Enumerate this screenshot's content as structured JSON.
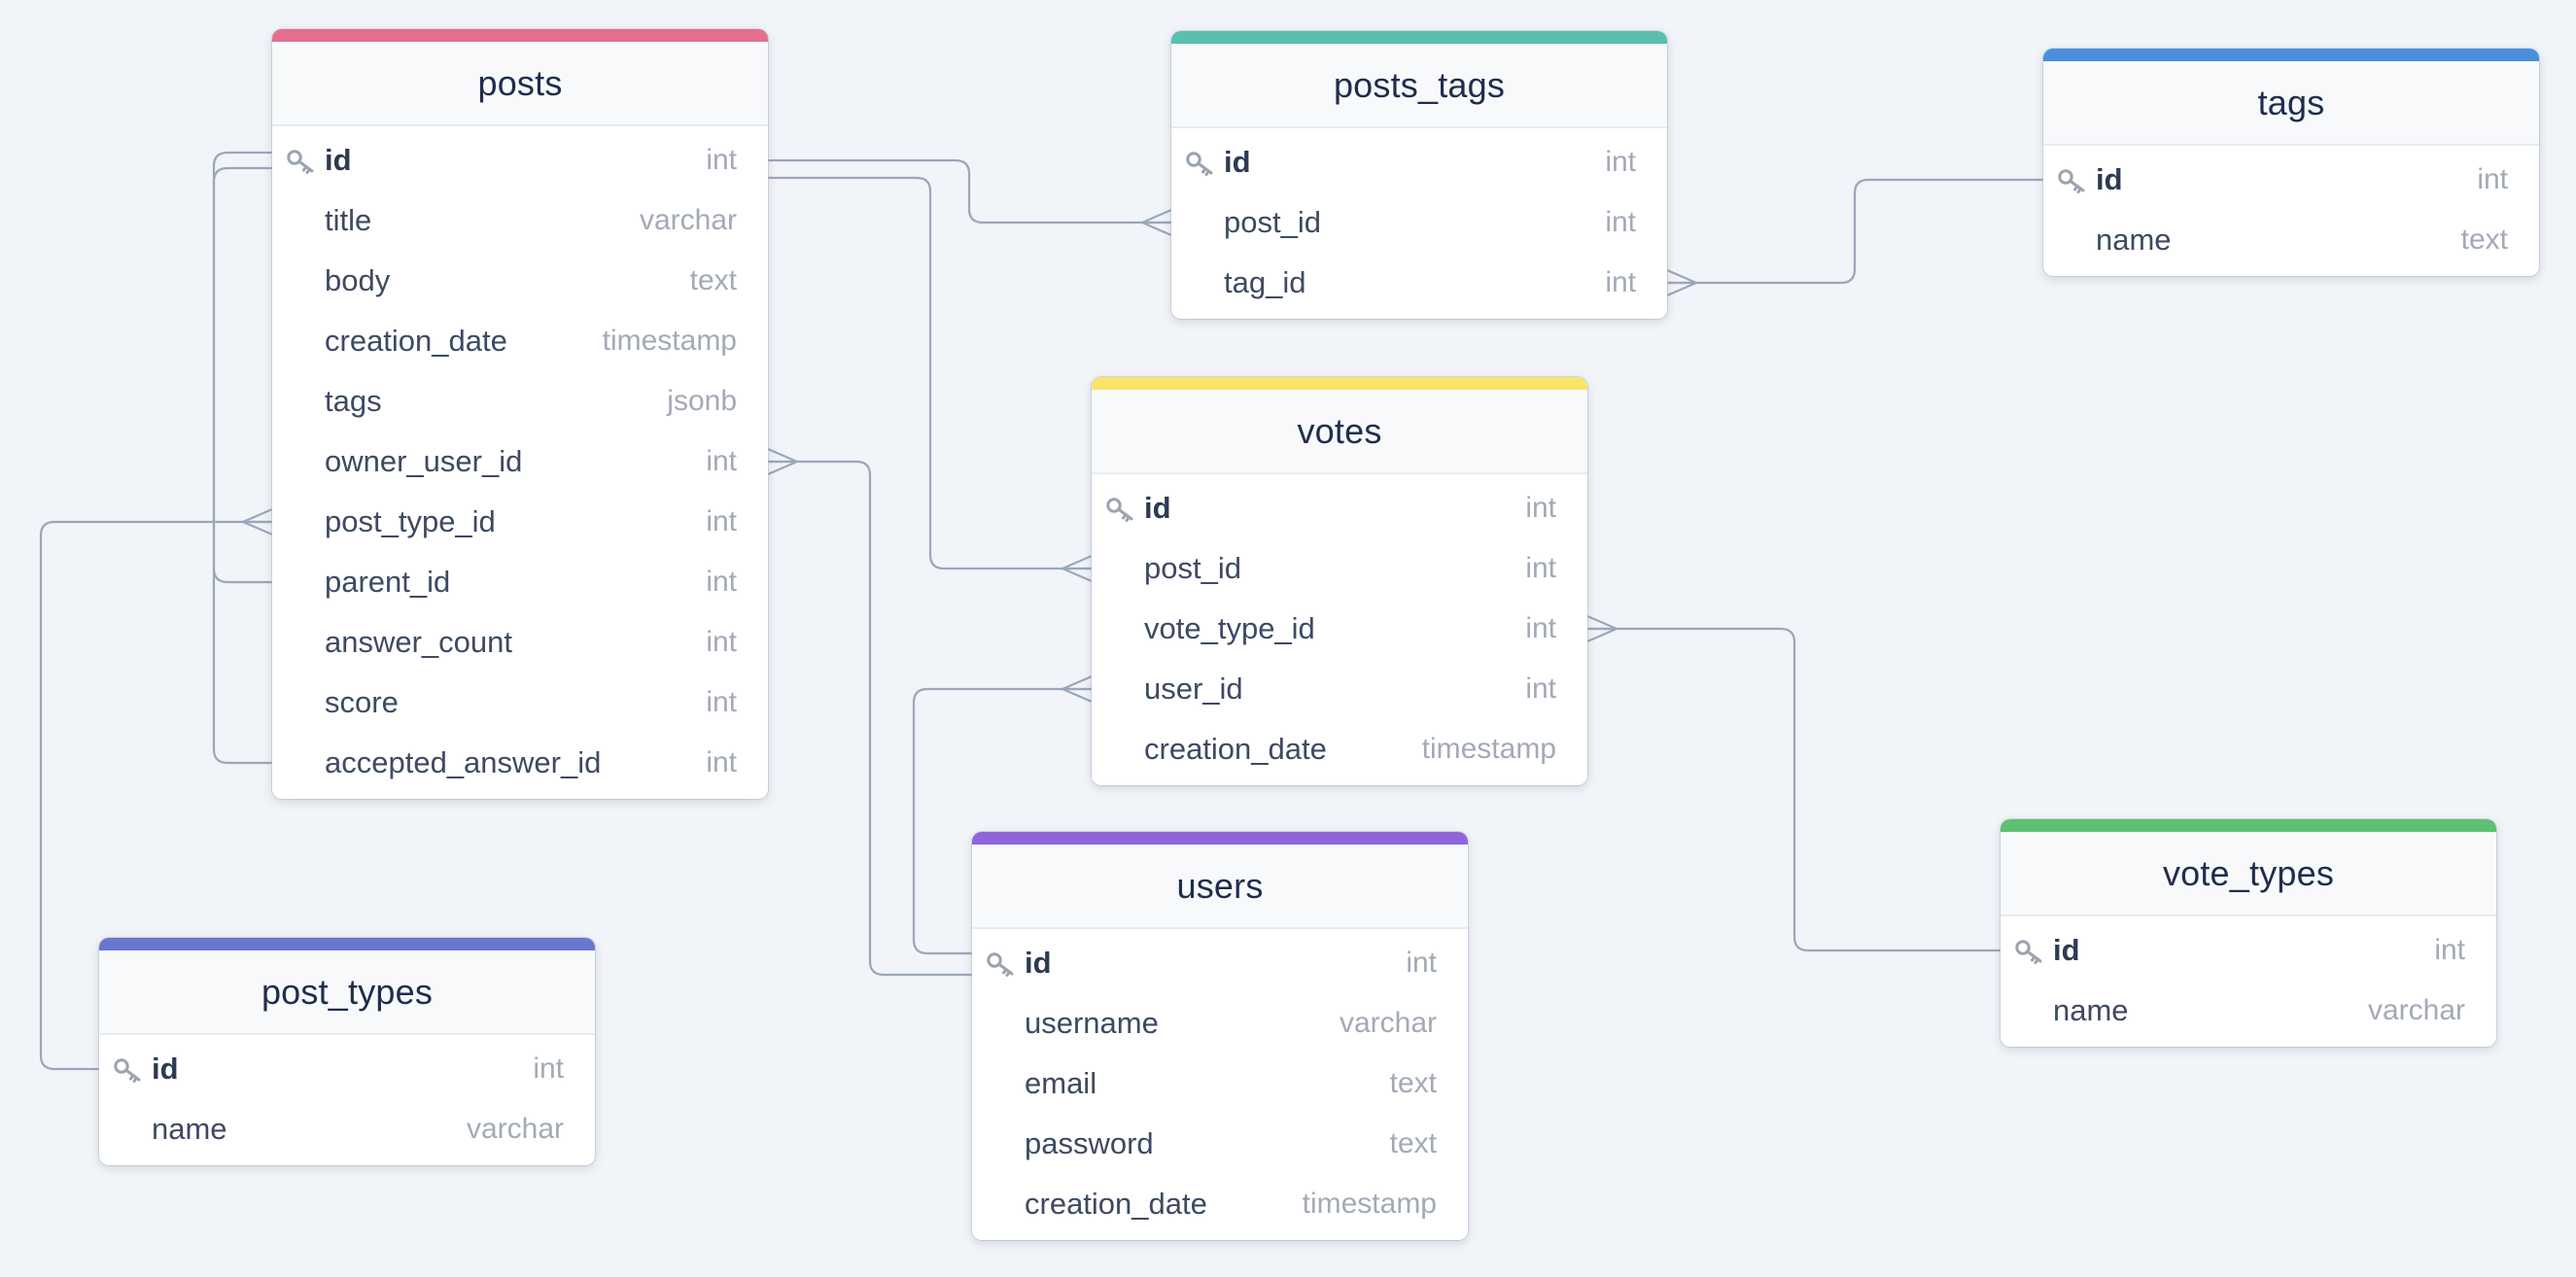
{
  "tables": [
    {
      "key": "posts",
      "name": "posts",
      "color": "#e2708e",
      "columns": [
        {
          "name": "id",
          "type": "int",
          "pk": true
        },
        {
          "name": "title",
          "type": "varchar"
        },
        {
          "name": "body",
          "type": "text"
        },
        {
          "name": "creation_date",
          "type": "timestamp"
        },
        {
          "name": "tags",
          "type": "jsonb"
        },
        {
          "name": "owner_user_id",
          "type": "int"
        },
        {
          "name": "post_type_id",
          "type": "int"
        },
        {
          "name": "parent_id",
          "type": "int"
        },
        {
          "name": "answer_count",
          "type": "int"
        },
        {
          "name": "score",
          "type": "int"
        },
        {
          "name": "accepted_answer_id",
          "type": "int"
        }
      ]
    },
    {
      "key": "posts_tags",
      "name": "posts_tags",
      "color": "#5bbfb0",
      "columns": [
        {
          "name": "id",
          "type": "int",
          "pk": true
        },
        {
          "name": "post_id",
          "type": "int"
        },
        {
          "name": "tag_id",
          "type": "int"
        }
      ]
    },
    {
      "key": "tags",
      "name": "tags",
      "color": "#4a8fdc",
      "columns": [
        {
          "name": "id",
          "type": "int",
          "pk": true
        },
        {
          "name": "name",
          "type": "text"
        }
      ]
    },
    {
      "key": "votes",
      "name": "votes",
      "color": "#f9e46a",
      "columns": [
        {
          "name": "id",
          "type": "int",
          "pk": true
        },
        {
          "name": "post_id",
          "type": "int"
        },
        {
          "name": "vote_type_id",
          "type": "int"
        },
        {
          "name": "user_id",
          "type": "int"
        },
        {
          "name": "creation_date",
          "type": "timestamp"
        }
      ]
    },
    {
      "key": "users",
      "name": "users",
      "color": "#8f66d9",
      "columns": [
        {
          "name": "id",
          "type": "int",
          "pk": true
        },
        {
          "name": "username",
          "type": "varchar"
        },
        {
          "name": "email",
          "type": "text"
        },
        {
          "name": "password",
          "type": "text"
        },
        {
          "name": "creation_date",
          "type": "timestamp"
        }
      ]
    },
    {
      "key": "post_types",
      "name": "post_types",
      "color": "#6a77cf",
      "columns": [
        {
          "name": "id",
          "type": "int",
          "pk": true
        },
        {
          "name": "name",
          "type": "varchar"
        }
      ]
    },
    {
      "key": "vote_types",
      "name": "vote_types",
      "color": "#5fbf72",
      "columns": [
        {
          "name": "id",
          "type": "int",
          "pk": true
        },
        {
          "name": "name",
          "type": "varchar"
        }
      ]
    }
  ],
  "relationships": [
    {
      "from": "posts_tags.post_id",
      "to": "posts.id",
      "cardinality": "many-to-one"
    },
    {
      "from": "posts_tags.tag_id",
      "to": "tags.id",
      "cardinality": "many-to-one"
    },
    {
      "from": "votes.post_id",
      "to": "posts.id",
      "cardinality": "many-to-one"
    },
    {
      "from": "votes.user_id",
      "to": "users.id",
      "cardinality": "many-to-one"
    },
    {
      "from": "votes.vote_type_id",
      "to": "vote_types.id",
      "cardinality": "many-to-one"
    },
    {
      "from": "posts.owner_user_id",
      "to": "users.id",
      "cardinality": "many-to-one"
    },
    {
      "from": "posts.post_type_id",
      "to": "post_types.id",
      "cardinality": "many-to-one"
    },
    {
      "from": "posts.parent_id",
      "to": "posts.id",
      "cardinality": "many-to-one"
    },
    {
      "from": "posts.accepted_answer_id",
      "to": "posts.id",
      "cardinality": "many-to-one"
    }
  ],
  "colors": {
    "background": "#f1f4f8",
    "connector": "#9aa7ba"
  },
  "icons": {
    "primary_key": "key-icon"
  }
}
